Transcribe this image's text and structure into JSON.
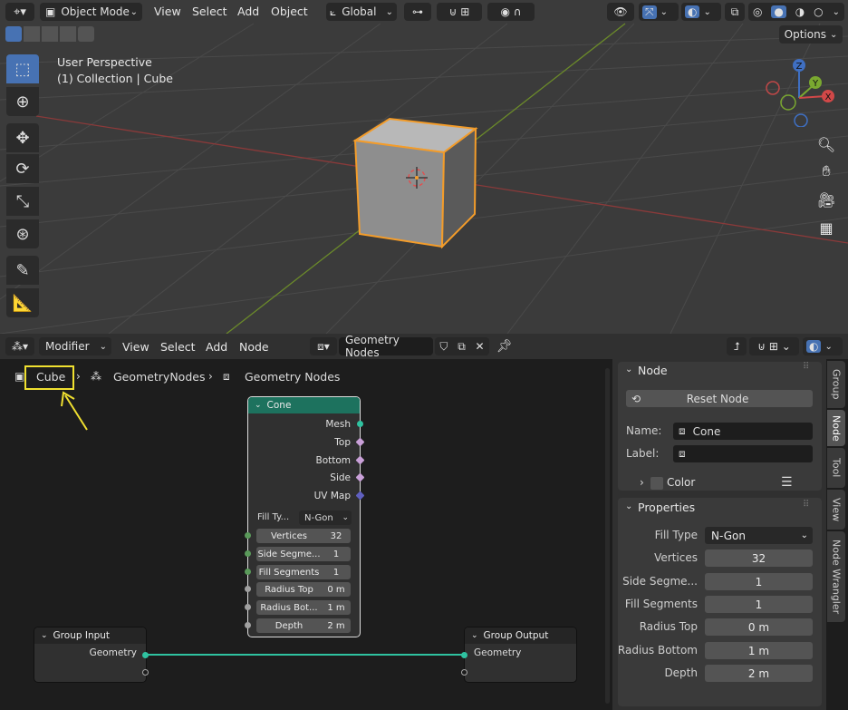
{
  "viewport": {
    "mode": "Object Mode",
    "menus": [
      "View",
      "Select",
      "Add",
      "Object"
    ],
    "orientation": "Global",
    "options": "Options",
    "perspective": "User Perspective",
    "collection": "(1) Collection | Cube",
    "gizmo": {
      "z": "Z",
      "y": "Y",
      "x": "X"
    }
  },
  "node_editor": {
    "modifier": "Modifier",
    "menus": [
      "View",
      "Select",
      "Add",
      "Node"
    ],
    "tree_name": "Geometry Nodes",
    "breadcrumb": [
      "Cube",
      "GeometryNodes",
      "Geometry Nodes"
    ]
  },
  "cone_node": {
    "title": "Cone",
    "outputs": [
      "Mesh",
      "Top",
      "Bottom",
      "Side",
      "UV Map"
    ],
    "fill_label": "Fill Ty...",
    "fill_value": "N-Gon",
    "fields": [
      {
        "label": "Vertices",
        "value": "32"
      },
      {
        "label": "Side Segme...",
        "value": "1"
      },
      {
        "label": "Fill Segments",
        "value": "1"
      },
      {
        "label": "Radius Top",
        "value": "0 m"
      },
      {
        "label": "Radius Bot...",
        "value": "1 m"
      },
      {
        "label": "Depth",
        "value": "2 m"
      }
    ]
  },
  "group_input": {
    "title": "Group Input",
    "socket": "Geometry"
  },
  "group_output": {
    "title": "Group Output",
    "socket": "Geometry"
  },
  "sidebar": {
    "node_section": "Node",
    "reset_button": "Reset Node",
    "name_label": "Name:",
    "name_value": "Cone",
    "label_label": "Label:",
    "color_label": "Color",
    "properties_section": "Properties",
    "props": [
      {
        "label": "Fill Type",
        "value": "N-Gon"
      },
      {
        "label": "Vertices",
        "value": "32"
      },
      {
        "label": "Side Segme...",
        "value": "1"
      },
      {
        "label": "Fill Segments",
        "value": "1"
      },
      {
        "label": "Radius Top",
        "value": "0 m"
      },
      {
        "label": "Radius Bottom",
        "value": "1 m"
      },
      {
        "label": "Depth",
        "value": "2 m"
      }
    ],
    "tabs": [
      "Group",
      "Node",
      "Tool",
      "View",
      "Node Wrangler"
    ]
  },
  "colors": {
    "accent": "#4772b3",
    "cone_header": "#1d725e",
    "highlight": "#f0e030",
    "selected_orange": "#f39c2a"
  }
}
